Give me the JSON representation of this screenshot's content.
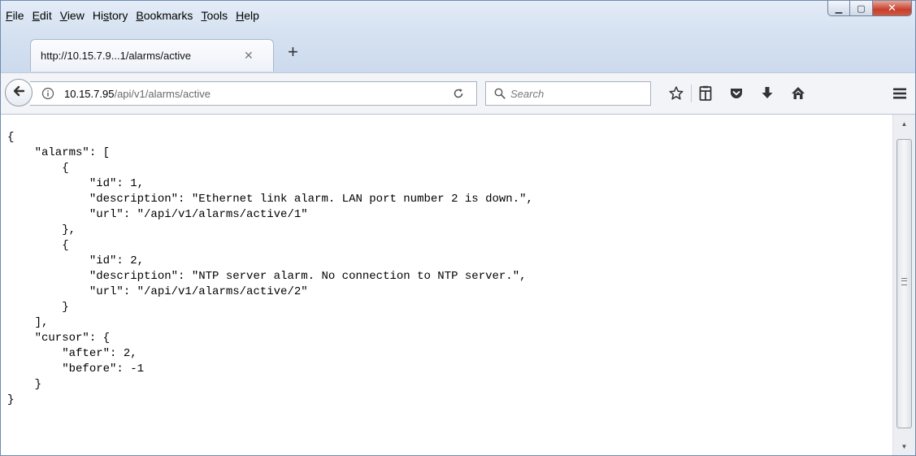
{
  "menu": {
    "items": [
      {
        "label": "File",
        "accel": "F",
        "rest": "ile"
      },
      {
        "label": "Edit",
        "accel": "E",
        "rest": "dit"
      },
      {
        "label": "View",
        "accel": "V",
        "rest": "iew"
      },
      {
        "label": "History",
        "pre": "Hi",
        "accel": "s",
        "rest": "tory"
      },
      {
        "label": "Bookmarks",
        "accel": "B",
        "rest": "ookmarks"
      },
      {
        "label": "Tools",
        "accel": "T",
        "rest": "ools"
      },
      {
        "label": "Help",
        "accel": "H",
        "rest": "elp"
      }
    ]
  },
  "window_controls": {
    "minimize": "▁",
    "maximize": "▢",
    "close": "✕"
  },
  "tab": {
    "title": "http://10.15.7.9...1/alarms/active",
    "close_glyph": "✕",
    "new_tab_glyph": "+"
  },
  "navbar": {
    "url_host": "10.15.7.95",
    "url_path": "/api/v1/alarms/active",
    "search_placeholder": "Search",
    "icons": [
      "back-arrow-icon",
      "info-icon",
      "reload-icon",
      "search-icon",
      "bookmark-star-icon",
      "reader-view-icon",
      "pocket-icon",
      "download-icon",
      "home-icon",
      "hamburger-menu-icon"
    ]
  },
  "content": {
    "json_lines": [
      "{",
      "    \"alarms\": [",
      "        {",
      "            \"id\": 1,",
      "            \"description\": \"Ethernet link alarm. LAN port number 2 is down.\",",
      "            \"url\": \"/api/v1/alarms/active/1\"",
      "        },",
      "        {",
      "            \"id\": 2,",
      "            \"description\": \"NTP server alarm. No connection to NTP server.\",",
      "            \"url\": \"/api/v1/alarms/active/2\"",
      "        }",
      "    ],",
      "    \"cursor\": {",
      "        \"after\": 2,",
      "        \"before\": -1",
      "    }",
      "}"
    ]
  },
  "colors": {
    "chrome": "#d6e2f1",
    "close_button": "#c7402c",
    "url_path": "#6a6a6a"
  }
}
